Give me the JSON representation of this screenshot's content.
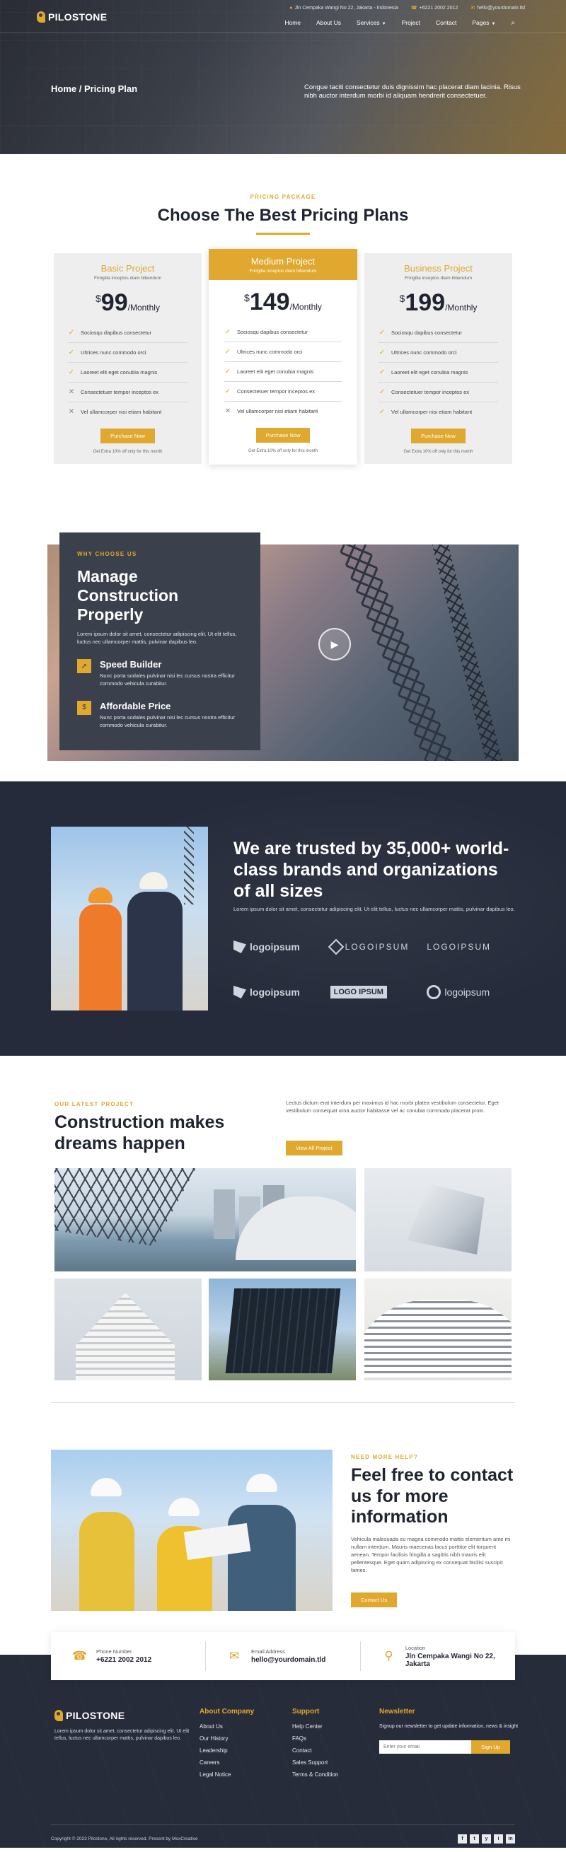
{
  "topbar": {
    "address": "Jln Cempaka Wangi No 22, Jakarta - Indonesia",
    "phone": "+6221 2002 2012",
    "email": "hello@yourdomain.tld"
  },
  "brand": {
    "name": "PILOSTONE"
  },
  "nav": {
    "items": [
      "Home",
      "About Us",
      "Services",
      "Project",
      "Contact",
      "Pages"
    ],
    "search_icon": "search-icon"
  },
  "hero": {
    "breadcrumb": "Home / Pricing Plan",
    "description": "Congue taciti consectetur duis dignissim hac placerat diam lacinia. Risus nibh auctor interdum morbi id aliquam hendrerit consectetuer."
  },
  "pricing": {
    "eyebrow": "PRICING PACKAGE",
    "title": "Choose The Best Pricing Plans",
    "plans": [
      {
        "name": "Basic Project",
        "subtitle": "Fringilla inceptos diam bibendum",
        "currency": "$",
        "amount": "99",
        "period": "/Monthly",
        "features": [
          {
            "text": "Sociosqu dapibus consectetur",
            "included": true
          },
          {
            "text": "Ultrices nunc commodo orci",
            "included": true
          },
          {
            "text": "Laoreet elit eget conubia magnis",
            "included": true
          },
          {
            "text": "Consectetuer tempor inceptos ex",
            "included": false
          },
          {
            "text": "Vel ullamcorper nisi etiam habitant",
            "included": false
          }
        ],
        "button": "Purchase Now",
        "note": "Get Extra 10% off only for this month"
      },
      {
        "name": "Medium Project",
        "subtitle": "Fringilla inceptos diam bibendum",
        "currency": "$",
        "amount": "149",
        "period": "/Monthly",
        "features": [
          {
            "text": "Sociosqu dapibus consectetur",
            "included": true
          },
          {
            "text": "Ultrices nunc commodo orci",
            "included": true
          },
          {
            "text": "Laoreet elit eget conubia magnis",
            "included": true
          },
          {
            "text": "Consectetuer tempor inceptos ex",
            "included": true
          },
          {
            "text": "Vel ullamcorper nisi etiam habitant",
            "included": false
          }
        ],
        "button": "Purchase Now",
        "note": "Get Extra 10% off only for this month"
      },
      {
        "name": "Business Project",
        "subtitle": "Fringilla inceptos diam bibendum",
        "currency": "$",
        "amount": "199",
        "period": "/Monthly",
        "features": [
          {
            "text": "Sociosqu dapibus consectetur",
            "included": true
          },
          {
            "text": "Ultrices nunc commodo orci",
            "included": true
          },
          {
            "text": "Laoreet elit eget conubia magnis",
            "included": true
          },
          {
            "text": "Consectetuer tempor inceptos ex",
            "included": true
          },
          {
            "text": "Vel ullamcorper nisi etiam habitant",
            "included": true
          }
        ],
        "button": "Purchase Now",
        "note": "Get Extra 10% off only for this month"
      }
    ]
  },
  "why": {
    "eyebrow": "WHY CHOOSE US",
    "title": "Manage Construction Properly",
    "description": "Lorem ipsum dolor sit amet, consectetur adipiscing elit. Ut elit tellus, luctus nec ullamcorper mattis, pulvinar dapibus leo.",
    "features": [
      {
        "title": "Speed Builder",
        "text": "Nunc porta sodales pulvinar nisi lec cursus nostra efficitur commodo vehicula curabitur."
      },
      {
        "title": "Affordable Price",
        "text": "Nunc porta sodales pulvinar nisi lec cursus nostra efficitur commodo vehicula curabitur."
      }
    ]
  },
  "trusted": {
    "title": "We are trusted by 35,000+ world-class brands and organizations of all sizes",
    "description": "Lorem ipsum dolor sit amet, consectetur adipiscing elit. Ut elit tellus, luctus nec ullamcorper mattis, pulvinar dapibus leo.",
    "logos": [
      "logoipsum",
      "LOGOIPSUM",
      "LOGOIPSUM",
      "logoipsum",
      "LOGO IPSUM",
      "logoipsum"
    ]
  },
  "projects": {
    "eyebrow": "OUR LATEST PROJECT",
    "title": "Construction makes dreams happen",
    "description": "Lectus dictum erat interdum per maximus id hac morbi platea vestibulum consectetur. Eget vestibulum consequat urna auctor habitasse vel ac conubia commodo placerat proin.",
    "button": "View All Project"
  },
  "cta": {
    "eyebrow": "NEED MORE HELP?",
    "title": "Feel free to contact us for more information",
    "description": "Vehicula malesuada eu magna commodo mattis elementum ante mi nullam interdum. Mauris maecenas lacus porttitor elit torquent aenean. Tempor facilisis fringilla a sagittis nibh mauris elit pellentesque. Eget quam adipiscing ex consequat facilisi suscipit fames.",
    "button": "Contact Us"
  },
  "contact_bar": [
    {
      "label": "Phone Number",
      "value": "+6221 2002 2012",
      "icon": "phone-icon"
    },
    {
      "label": "Email Address",
      "value": "hello@yourdomain.tld",
      "icon": "envelope-icon"
    },
    {
      "label": "Location",
      "value": "Jln Cempaka Wangi No 22, Jakarta",
      "icon": "location-pin-icon"
    }
  ],
  "footer": {
    "description": "Lorem ipsum dolor sit amet, consectetur adipiscing elit. Ut elit tellus, luctus nec ullamcorper mattis, pulvinar dapibus leo.",
    "about_title": "About Company",
    "about_links": [
      "About Us",
      "Our History",
      "Leadership",
      "Careers",
      "Legal Notice"
    ],
    "support_title": "Support",
    "support_links": [
      "Help Center",
      "FAQs",
      "Contact",
      "Sales Support",
      "Terms & Condition"
    ],
    "newsletter_title": "Newsletter",
    "newsletter_text": "Signup our newsletter to get update information, news & insight",
    "email_placeholder": "Enter your email",
    "signup_button": "Sign Up",
    "copyright": "Copyright © 2023 Pilostone, All rights reserved. Present by MoxCreative",
    "socials": [
      "f",
      "t",
      "y",
      "i",
      "in"
    ]
  },
  "colors": {
    "accent": "#e0a82e",
    "dark": "#252b3a",
    "card_dark": "#3a404c"
  }
}
